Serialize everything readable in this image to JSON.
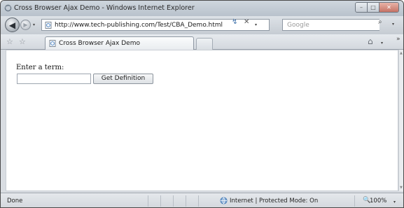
{
  "window": {
    "title": "Cross Browser Ajax Demo - Windows Internet Explorer",
    "min_symbol": "–",
    "max_symbol": "□",
    "close_symbol": "✕"
  },
  "navbar": {
    "back_symbol": "◀",
    "forward_symbol": "▶",
    "dropdown_symbol": "▾",
    "address": "http://www.tech-publishing.com/Test/CBA_Demo.html",
    "refresh_symbol": "↯",
    "stop_symbol": "✕",
    "search_placeholder": "Google",
    "search_symbol": "⌕"
  },
  "tabbar": {
    "favorites_symbol": "☆",
    "add_favorites_symbol": "☆",
    "tab_title": "Cross Browser Ajax Demo",
    "home_symbol": "⌂",
    "more_symbol": "»"
  },
  "page": {
    "term_label": "Enter a term:",
    "term_value": "",
    "button_label": "Get Definition"
  },
  "status": {
    "text": "Done",
    "zone": "Internet | Protected Mode: On",
    "zoom": "100%",
    "zoom_symbol": "🔍"
  },
  "colors": {
    "ie_icon": "#5b8fc9",
    "globe": "#4a7fb8"
  }
}
